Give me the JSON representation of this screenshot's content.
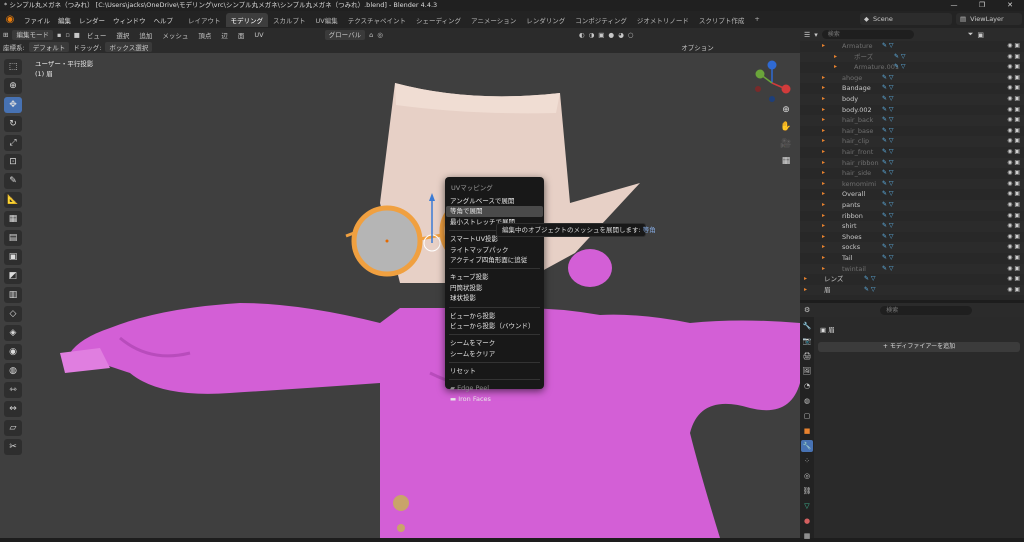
{
  "window": {
    "title": "* シンプル丸メガネ（つみれ） [C:\\Users\\jacks\\OneDrive\\モデリング\\vrc\\シンプル丸メガネ\\シンプル丸メガネ（つみれ）.blend] - Blender 4.4.3",
    "controls": [
      "—",
      "❐",
      "✕"
    ]
  },
  "menubar": {
    "items": [
      "ファイル",
      "編集",
      "レンダー",
      "ウィンドウ",
      "ヘルプ"
    ],
    "workspaces": [
      "レイアウト",
      "モデリング",
      "スカルプト",
      "UV編集",
      "テクスチャペイント",
      "シェーディング",
      "アニメーション",
      "レンダリング",
      "コンポジティング",
      "ジオメトリノード",
      "スクリプト作成"
    ],
    "active_workspace": "モデリング",
    "add_tab": "+",
    "scene": "Scene",
    "view_layer": "ViewLayer"
  },
  "viewport_header": {
    "mode": "編集モード",
    "menus": [
      "ビュー",
      "選択",
      "追加",
      "メッシュ",
      "頂点",
      "辺",
      "面",
      "UV"
    ],
    "transform": "グローバル",
    "options": "オプション"
  },
  "viewport_header2": {
    "orientation_label": "座標系:",
    "orientation": "デフォルト",
    "drag_label": "ドラッグ:",
    "drag": "ボックス選択"
  },
  "viewport": {
    "view_name": "ユーザー・平行投影",
    "object_name": "(1) 眉"
  },
  "uv_menu": {
    "title": "UVマッピング",
    "items": [
      {
        "label": "アングルベースで展開",
        "state": "normal"
      },
      {
        "label": "等角で展開",
        "state": "highlighted"
      },
      {
        "label": "最小ストレッチで展開",
        "state": "normal"
      },
      {
        "label": "スマートUV投影",
        "state": "normal"
      },
      {
        "label": "ライトマップパック",
        "state": "normal"
      },
      {
        "label": "アクティブ四角形面に追従",
        "state": "normal"
      },
      {
        "label": "キューブ投影",
        "state": "normal"
      },
      {
        "label": "円筒状投影",
        "state": "normal"
      },
      {
        "label": "球状投影",
        "state": "normal"
      },
      {
        "label": "ビューから投影",
        "state": "normal"
      },
      {
        "label": "ビューから投影（バウンド）",
        "state": "normal"
      },
      {
        "label": "シームをマーク",
        "state": "normal"
      },
      {
        "label": "シームをクリア",
        "state": "normal"
      },
      {
        "label": "リセット",
        "state": "normal"
      },
      {
        "label": "Edge Peel",
        "state": "disabled"
      },
      {
        "label": "Iron Faces",
        "state": "normal"
      }
    ]
  },
  "tooltip": {
    "text": "編集中のオブジェクトのメッシュを展開します: ",
    "keyword": "等角"
  },
  "outliner": {
    "search_placeholder": "検索",
    "rows": [
      {
        "name": "Armature",
        "dim": true
      },
      {
        "name": "ポーズ",
        "dim": true
      },
      {
        "name": "Armature.001",
        "dim": true
      },
      {
        "name": "ahoge",
        "dim": true
      },
      {
        "name": "Bandage",
        "dim": false
      },
      {
        "name": "body",
        "dim": false
      },
      {
        "name": "body.002",
        "dim": false
      },
      {
        "name": "hair_back",
        "dim": true
      },
      {
        "name": "hair_base",
        "dim": true
      },
      {
        "name": "hair_clip",
        "dim": true
      },
      {
        "name": "hair_front",
        "dim": true
      },
      {
        "name": "hair_ribbon",
        "dim": true
      },
      {
        "name": "hair_side",
        "dim": true
      },
      {
        "name": "kemomimi",
        "dim": true
      },
      {
        "name": "Overall",
        "dim": false
      },
      {
        "name": "pants",
        "dim": false
      },
      {
        "name": "ribbon",
        "dim": false
      },
      {
        "name": "shirt",
        "dim": false
      },
      {
        "name": "Shoes",
        "dim": false
      },
      {
        "name": "socks",
        "dim": false
      },
      {
        "name": "Tail",
        "dim": false
      },
      {
        "name": "twintail",
        "dim": true
      },
      {
        "name": "レンズ",
        "dim": false
      },
      {
        "name": "眉",
        "dim": false
      }
    ]
  },
  "properties": {
    "search_placeholder": "検索",
    "object": "眉",
    "add_modifier": "モディファイアーを追加"
  },
  "colors": {
    "accent": "#4772b3",
    "selection_orange": "#f0a040",
    "mesh_pink": "#d35fd6"
  }
}
